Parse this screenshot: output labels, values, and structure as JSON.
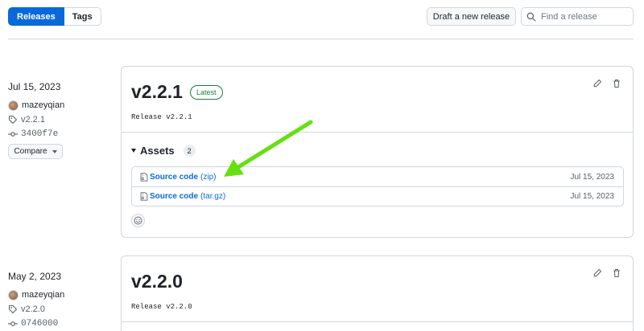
{
  "toolbar": {
    "tab_releases": "Releases",
    "tab_tags": "Tags",
    "draft_button": "Draft a new release",
    "search_placeholder": "Find a release"
  },
  "releases": [
    {
      "date": "Jul 15, 2023",
      "author": "mazeyqian",
      "tag": "v2.2.1",
      "commit": "3400f7e",
      "compare_label": "Compare",
      "title": "v2.2.1",
      "badge": "Latest",
      "description": "Release v2.2.1",
      "assets_label": "Assets",
      "assets_count": "2",
      "assets": [
        {
          "name": "Source code",
          "ext": "(zip)",
          "date": "Jul 15, 2023"
        },
        {
          "name": "Source code",
          "ext": "(tar.gz)",
          "date": "Jul 15, 2023"
        }
      ]
    },
    {
      "date": "May 2, 2023",
      "author": "mazeyqian",
      "tag": "v2.2.0",
      "commit": "0746000",
      "title": "v2.2.0",
      "description": "Release v2.2.0"
    }
  ],
  "colors": {
    "accent": "#0969da",
    "latest_green": "#1a7f37",
    "annotation_arrow": "#66e00f"
  },
  "icons": [
    "search-icon",
    "tag-icon",
    "commit-icon",
    "pencil-icon",
    "trash-icon",
    "file-zip-icon",
    "smiley-icon",
    "annotation-arrow"
  ]
}
